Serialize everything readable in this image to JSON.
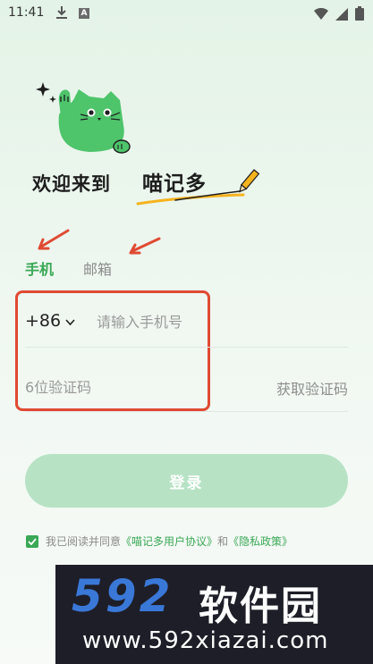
{
  "status_bar": {
    "time": "11:41",
    "download_icon": "download-icon",
    "notification_badge": "A"
  },
  "welcome": {
    "prefix": "欢迎来到",
    "brand": "喵记多"
  },
  "tabs": [
    {
      "label": "手机",
      "active": true
    },
    {
      "label": "邮箱",
      "active": false
    }
  ],
  "phone": {
    "country_code": "+86",
    "placeholder": "请输入手机号"
  },
  "code": {
    "placeholder": "6位验证码",
    "get_code_label": "获取验证码"
  },
  "login": {
    "label": "登录"
  },
  "agreement": {
    "prefix": "我已阅读并同意",
    "terms": "《喵记多用户协议》",
    "and": "和",
    "privacy": "《隐私政策》",
    "checked": true
  },
  "watermark": {
    "logo": "592",
    "name": "软件园",
    "url": "www.592xiazai.com"
  },
  "colors": {
    "accent": "#3aa856",
    "button_disabled": "#b7e3c4",
    "annotation": "#e04a33"
  }
}
